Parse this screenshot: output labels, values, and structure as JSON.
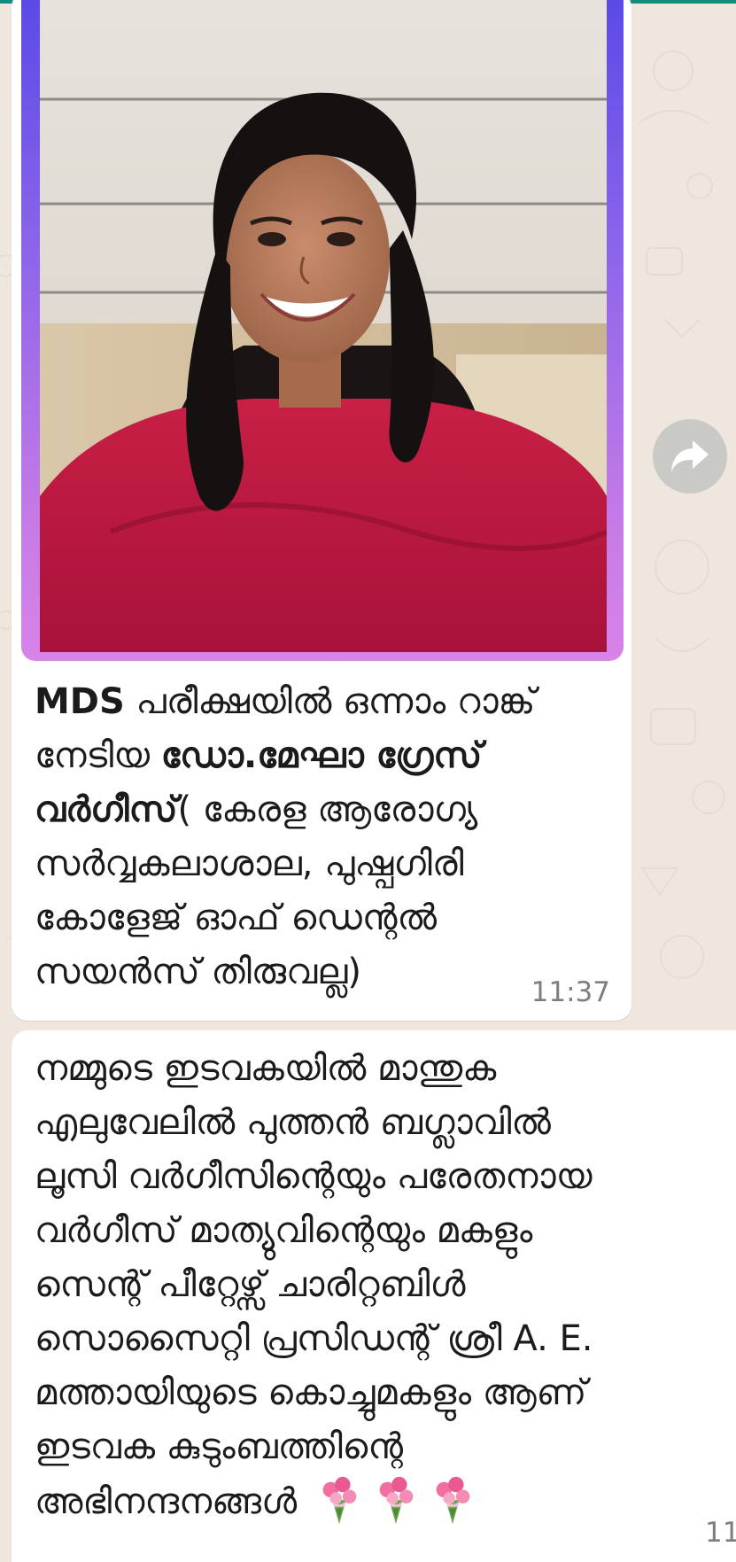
{
  "colors": {
    "chat_background": "#efe7dd",
    "bubble": "#ffffff",
    "header_strip": "#128c7e",
    "timestamp": "#7a7f83",
    "frame_gradient_top": "#5b4ae6",
    "frame_gradient_bottom": "#d884e8"
  },
  "message1": {
    "image_alt": "Photo of a smiling woman in a red top with shoulder-length dark hair",
    "text_bold_1": "MDS",
    "text_1": " പരീക്ഷയിൽ ഒന്നാം റാങ്ക് നേടിയ ",
    "text_bold_2": "ഡോ.മേഘാ ഗ്രേസ് വർഗീസ്",
    "text_2": "( കേരള ആരോഗ്യ സർവ്വകലാശാല, പുഷ്പഗിരി കോളേജ് ഓഫ് ഡെന്റൽ സയൻസ് തിരുവല്ല)",
    "time": "11:37"
  },
  "message2": {
    "lines": [
      "നമ്മുടെ ഇടവകയിൽ മാന്തുക",
      "എലുവേലിൽ പുത്തൻ ബഗ്ലാവിൽ",
      "ലൂസി വർഗീസിന്റെയും പരേതനായ",
      "വർഗീസ് മാത്യുവിന്റെയും മകളും",
      "സെന്റ് പീറ്റേഴ്സ് ചാരിറ്റബിൾ",
      "സൊസൈറ്റി പ്രസിഡന്റ് ശ്രീ A. E.",
      "മത്തായിയുടെ കൊച്ചുമകളും ആണ്",
      "ഇടവക കുടുംബത്തിന്റെ",
      "അഭിനന്ദനങ്ങൾ"
    ],
    "emoji_icons": [
      "bouquet-icon",
      "bouquet-icon",
      "bouquet-icon"
    ],
    "time": "11"
  },
  "forward_icon": "forward-arrow-icon"
}
